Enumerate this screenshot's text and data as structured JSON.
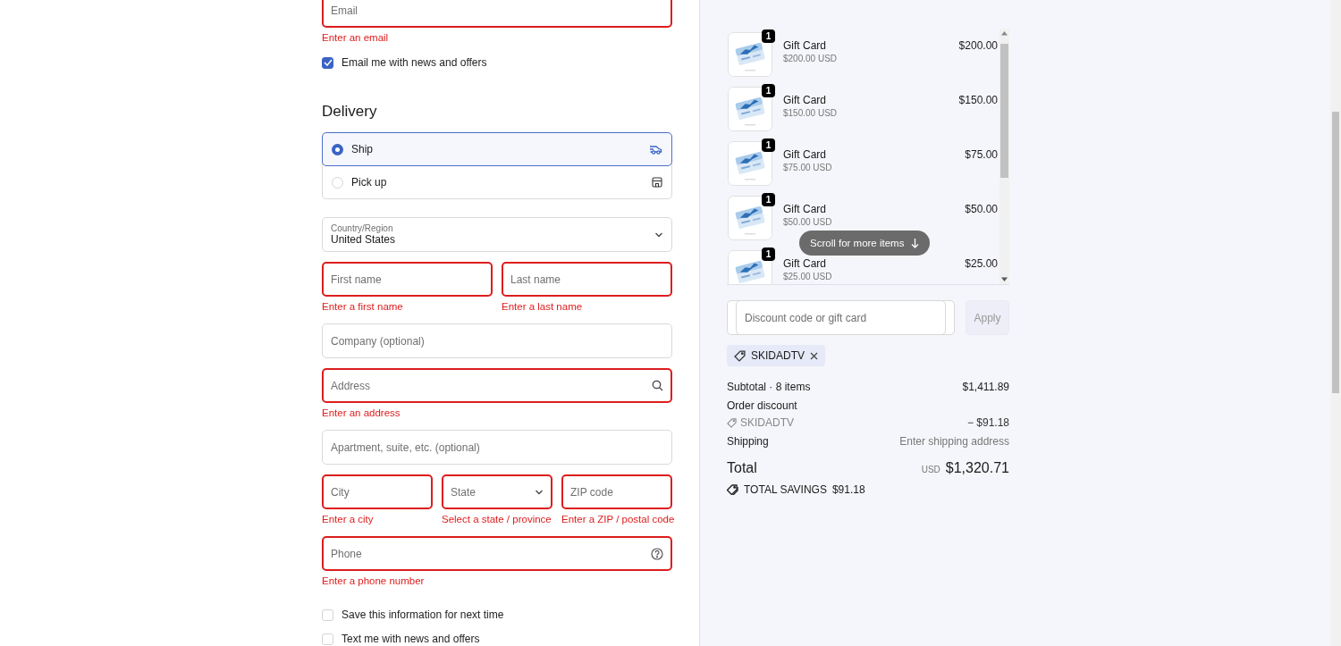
{
  "contact": {
    "email": {
      "placeholder": "Email",
      "invalid": true,
      "error": "Enter an email"
    },
    "newsletter": {
      "label": "Email me with news and offers",
      "checked": true
    }
  },
  "delivery": {
    "title": "Delivery",
    "options": [
      {
        "kind": "ship",
        "label": "Ship",
        "selected": true
      },
      {
        "kind": "pickup",
        "label": "Pick up",
        "selected": false
      }
    ],
    "rows": [
      [
        {
          "kind": "select",
          "label": "Country/Region",
          "value": "United States",
          "invalid": false
        }
      ],
      [
        {
          "kind": "text",
          "placeholder": "First name",
          "invalid": true,
          "error": "Enter a first name"
        },
        {
          "kind": "text",
          "placeholder": "Last name",
          "invalid": true,
          "error": "Enter a last name"
        }
      ],
      [
        {
          "kind": "text",
          "placeholder": "Company (optional)",
          "invalid": false
        }
      ],
      [
        {
          "kind": "lookup",
          "placeholder": "Address",
          "invalid": true,
          "error": "Enter an address"
        }
      ],
      [
        {
          "kind": "text",
          "placeholder": "Apartment, suite, etc. (optional)",
          "invalid": false
        }
      ],
      [
        {
          "kind": "text",
          "placeholder": "City",
          "invalid": true,
          "error": "Enter a city"
        },
        {
          "kind": "select",
          "placeholder": "State",
          "invalid": true,
          "error": "Select a state / province"
        },
        {
          "kind": "text",
          "placeholder": "ZIP code",
          "invalid": true,
          "error": "Enter a ZIP / postal code"
        }
      ],
      [
        {
          "kind": "help",
          "placeholder": "Phone",
          "invalid": true,
          "error": "Enter a phone number"
        }
      ]
    ],
    "checkboxes": [
      {
        "label": "Save this information for next time",
        "checked": false
      },
      {
        "label": "Text me with news and offers",
        "checked": false
      }
    ]
  },
  "summary": {
    "items": [
      {
        "quantity": "1",
        "name": "Gift Card",
        "subtitle": "$200.00 USD",
        "price": "$200.00"
      },
      {
        "quantity": "1",
        "name": "Gift Card",
        "subtitle": "$150.00 USD",
        "price": "$150.00"
      },
      {
        "quantity": "1",
        "name": "Gift Card",
        "subtitle": "$75.00 USD",
        "price": "$75.00"
      },
      {
        "quantity": "1",
        "name": "Gift Card",
        "subtitle": "$50.00 USD",
        "price": "$50.00"
      },
      {
        "quantity": "1",
        "name": "Gift Card",
        "subtitle": "$25.00 USD",
        "price": "$25.00"
      }
    ],
    "scroll_hint": "Scroll for more items",
    "discount": {
      "placeholder": "Discount code or gift card",
      "button": "Apply",
      "disabled": true
    },
    "applied_code": "SKIDADTV",
    "lines": [
      {
        "kind": "plain",
        "label": "Subtotal · 8 items",
        "value": "$1,411.89"
      },
      {
        "kind": "heading",
        "label": "Order discount"
      },
      {
        "kind": "code",
        "label": "SKIDADTV",
        "value": "− $91.18"
      },
      {
        "kind": "muted",
        "label": "Shipping",
        "value": "Enter shipping address"
      }
    ],
    "total": {
      "label": "Total",
      "currency": "USD",
      "value": "$1,320.71"
    },
    "savings": {
      "label": "TOTAL SAVINGS",
      "value": "$91.18"
    }
  }
}
